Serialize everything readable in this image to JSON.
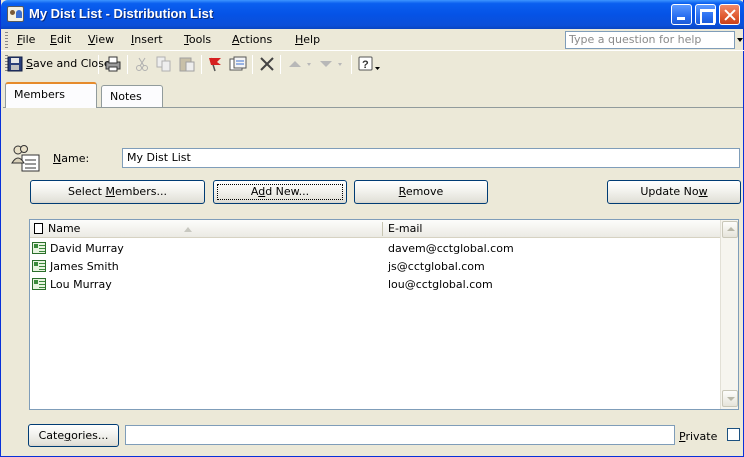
{
  "window": {
    "title": "My Dist List - Distribution List"
  },
  "menubar": {
    "items": [
      "File",
      "Edit",
      "View",
      "Insert",
      "Tools",
      "Actions",
      "Help"
    ],
    "ask_placeholder": "Type a question for help"
  },
  "toolbar": {
    "save_close_label": "Save and Close",
    "icons": [
      "save-icon",
      "print-icon",
      "cut-icon",
      "copy-icon",
      "paste-icon",
      "flag-icon",
      "new-item-icon",
      "delete-icon",
      "previous-item-icon",
      "next-item-icon",
      "help-icon"
    ]
  },
  "tabs": [
    {
      "label": "Members",
      "active": true
    },
    {
      "label": "Notes",
      "active": false
    }
  ],
  "form": {
    "name_label": "Name:",
    "name_value": "My Dist List",
    "buttons": {
      "select_members": "Select Members...",
      "add_new": "Add New...",
      "remove": "Remove",
      "update_now": "Update Now"
    }
  },
  "members": {
    "columns": [
      "Name",
      "E-mail"
    ],
    "rows": [
      {
        "name": "David Murray",
        "email": "davem@cctglobal.com"
      },
      {
        "name": "James Smith",
        "email": "js@cctglobal.com"
      },
      {
        "name": "Lou Murray",
        "email": "lou@cctglobal.com"
      }
    ]
  },
  "footer": {
    "categories_label": "Categories...",
    "categories_value": "",
    "private_label": "Private",
    "private_checked": false
  },
  "colors": {
    "titlebar": "#0553e6",
    "face": "#ece9d8",
    "active_tab_accent": "#e68b2c",
    "field_border": "#7f9db9"
  }
}
